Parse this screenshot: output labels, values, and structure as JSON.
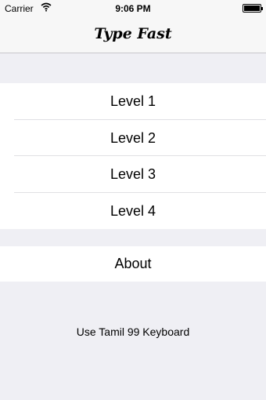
{
  "status_bar": {
    "carrier": "Carrier",
    "time": "9:06 PM",
    "wifi_icon": "wifi-icon",
    "battery_icon": "battery-icon"
  },
  "nav": {
    "title": "Type Fast"
  },
  "menu": {
    "levels": [
      "Level 1",
      "Level 2",
      "Level 3",
      "Level 4"
    ],
    "about": "About"
  },
  "footer": {
    "note": "Use Tamil 99 Keyboard"
  }
}
